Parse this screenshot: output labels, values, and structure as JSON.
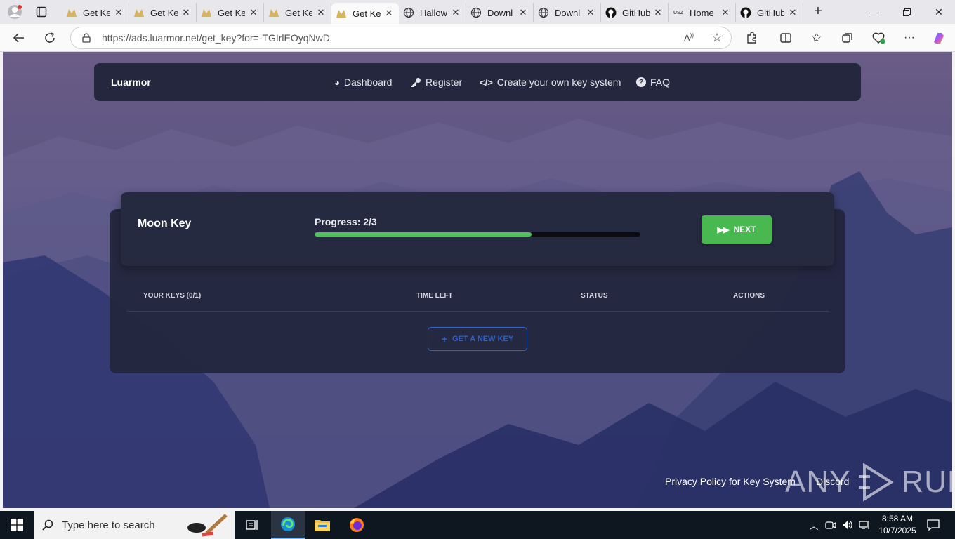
{
  "browser": {
    "tabs": [
      {
        "label": "Get Ke",
        "favicon": "luarmor-icon",
        "active": false
      },
      {
        "label": "Get Ke",
        "favicon": "luarmor-icon",
        "active": false
      },
      {
        "label": "Get Ke",
        "favicon": "luarmor-icon",
        "active": false
      },
      {
        "label": "Get Ke",
        "favicon": "luarmor-icon",
        "active": false
      },
      {
        "label": "Get Ke",
        "favicon": "luarmor-icon",
        "active": true
      },
      {
        "label": "Hallow",
        "favicon": "globe-icon",
        "active": false
      },
      {
        "label": "Downl",
        "favicon": "globe-icon",
        "active": false
      },
      {
        "label": "Downl",
        "favicon": "globe-icon",
        "active": false
      },
      {
        "label": "GitHub",
        "favicon": "github-icon",
        "active": false
      },
      {
        "label": "Home",
        "favicon": "usz-icon",
        "active": false
      },
      {
        "label": "GitHub",
        "favicon": "github-icon",
        "active": false
      }
    ],
    "usz_favicon_text": "USZ",
    "address": {
      "host": "https://ads.luarmor.net",
      "path": "/get_key?for=-TGIrlEOyqNwD"
    }
  },
  "site": {
    "brand": "Luarmor",
    "nav": {
      "dashboard": "Dashboard",
      "register": "Register",
      "create": "Create your own key system",
      "faq": "FAQ"
    },
    "card": {
      "title": "Moon Key",
      "progress_label": "Progress: 2/3",
      "progress_fraction": 0.667,
      "next_label": "NEXT",
      "next_color": "#48b94f",
      "progress_color": "#4fc05b"
    },
    "table": {
      "headers": [
        "YOUR KEYS (0/1)",
        "TIME LEFT",
        "STATUS",
        "ACTIONS"
      ],
      "new_key_label": "GET A NEW KEY"
    },
    "footer": {
      "privacy": "Privacy Policy for Key System",
      "discord": "Discord"
    },
    "watermark": {
      "left": "ANY",
      "right": "RUN"
    }
  },
  "taskbar": {
    "search_placeholder": "Type here to search",
    "time": "8:58 AM",
    "date": "10/7/2025"
  }
}
